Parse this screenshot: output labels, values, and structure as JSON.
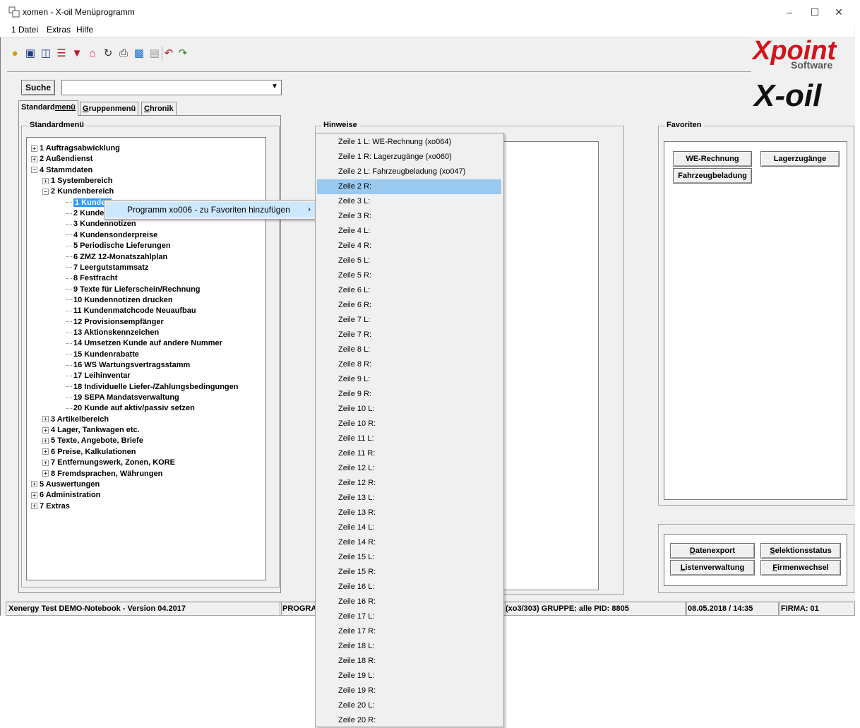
{
  "window": {
    "title": "xomen - X-oil Menüprogramm"
  },
  "menubar": [
    "1 Datei",
    "Extras",
    "Hilfe"
  ],
  "toolbar": [
    "lightbulb-icon",
    "info-icon",
    "book-icon",
    "database-icon",
    "filter-icon",
    "house-icon",
    "refresh-icon",
    "print-icon",
    "screen-icon",
    "save-icon",
    "undo-icon",
    "redo-icon"
  ],
  "logos": {
    "xpoint": "Xpoint",
    "software": "Software",
    "xoil": "X-oil"
  },
  "search": {
    "button": "Suche",
    "value": ""
  },
  "tabs": [
    {
      "pre": "Standard",
      "u": "menü",
      "post": ""
    },
    {
      "pre": "",
      "u": "G",
      "post": "ruppenmenü"
    },
    {
      "pre": "",
      "u": "C",
      "post": "hronik"
    }
  ],
  "std_group_title": "Standardmenü",
  "tree": [
    {
      "label": "1 Auftragsabwicklung",
      "level": 0,
      "exp": "+"
    },
    {
      "label": "2 Außendienst",
      "level": 0,
      "exp": "+"
    },
    {
      "label": "4 Stammdaten",
      "level": 0,
      "exp": "-"
    },
    {
      "label": "1 Systembereich",
      "level": 1,
      "exp": "+"
    },
    {
      "label": "2 Kundenbereich",
      "level": 1,
      "exp": "-"
    },
    {
      "label": "1 Kunden",
      "level": 2,
      "exp": "",
      "selected": true
    },
    {
      "label": "2 Kunder",
      "level": 2,
      "exp": ""
    },
    {
      "label": "3 Kundennotizen",
      "level": 2,
      "exp": ""
    },
    {
      "label": "4 Kundensonderpreise",
      "level": 2,
      "exp": ""
    },
    {
      "label": "5 Periodische Lieferungen",
      "level": 2,
      "exp": ""
    },
    {
      "label": "6 ZMZ 12-Monatszahlplan",
      "level": 2,
      "exp": ""
    },
    {
      "label": "7 Leergutstammsatz",
      "level": 2,
      "exp": ""
    },
    {
      "label": "8 Festfracht",
      "level": 2,
      "exp": ""
    },
    {
      "label": "9 Texte für Lieferschein/Rechnung",
      "level": 2,
      "exp": ""
    },
    {
      "label": "10 Kundennotizen drucken",
      "level": 2,
      "exp": ""
    },
    {
      "label": "11 Kundenmatchcode Neuaufbau",
      "level": 2,
      "exp": ""
    },
    {
      "label": "12 Provisionsempfänger",
      "level": 2,
      "exp": ""
    },
    {
      "label": "13 Aktionskennzeichen",
      "level": 2,
      "exp": ""
    },
    {
      "label": "14 Umsetzen Kunde auf andere Nummer",
      "level": 2,
      "exp": ""
    },
    {
      "label": "15 Kundenrabatte",
      "level": 2,
      "exp": ""
    },
    {
      "label": "16 WS Wartungsvertragsstamm",
      "level": 2,
      "exp": ""
    },
    {
      "label": "17 Leihinventar",
      "level": 2,
      "exp": ""
    },
    {
      "label": "18 Individuelle Liefer-/Zahlungsbedingungen",
      "level": 2,
      "exp": ""
    },
    {
      "label": "19 SEPA Mandatsverwaltung",
      "level": 2,
      "exp": ""
    },
    {
      "label": "20 Kunde auf aktiv/passiv setzen",
      "level": 2,
      "exp": ""
    },
    {
      "label": "3 Artikelbereich",
      "level": 1,
      "exp": "+"
    },
    {
      "label": "4 Lager, Tankwagen etc.",
      "level": 1,
      "exp": "+"
    },
    {
      "label": "5 Texte, Angebote, Briefe",
      "level": 1,
      "exp": "+"
    },
    {
      "label": "6 Preise, Kalkulationen",
      "level": 1,
      "exp": "+"
    },
    {
      "label": "7 Entfernungswerk, Zonen, KORE",
      "level": 1,
      "exp": "+"
    },
    {
      "label": "8 Fremdsprachen, Währungen",
      "level": 1,
      "exp": "+"
    },
    {
      "label": "5 Auswertungen",
      "level": 0,
      "exp": "+"
    },
    {
      "label": "6 Administration",
      "level": 0,
      "exp": "+"
    },
    {
      "label": "7 Extras",
      "level": 0,
      "exp": "+"
    }
  ],
  "context_menu": {
    "label": "Programm xo006 - zu Favoriten hinzufügen",
    "arrow": "›"
  },
  "hinweise_title": "Hinweise",
  "submenu": [
    "Zeile 1 L: WE-Rechnung (xo064)",
    "Zeile 1 R: Lagerzugänge (xo060)",
    "Zeile 2 L: Fahrzeugbeladung (xo047)",
    "Zeile 2 R:",
    "Zeile 3 L:",
    "Zeile 3 R:",
    "Zeile 4 L:",
    "Zeile 4 R:",
    "Zeile 5 L:",
    "Zeile 5 R:",
    "Zeile 6 L:",
    "Zeile 6 R:",
    "Zeile 7 L:",
    "Zeile 7 R:",
    "Zeile 8 L:",
    "Zeile 8 R:",
    "Zeile 9 L:",
    "Zeile 9 R:",
    "Zeile 10 L:",
    "Zeile 10 R:",
    "Zeile 11 L:",
    "Zeile 11 R:",
    "Zeile 12 L:",
    "Zeile 12 R:",
    "Zeile 13 L:",
    "Zeile 13 R:",
    "Zeile 14 L:",
    "Zeile 14 R:",
    "Zeile 15 L:",
    "Zeile 15 R:",
    "Zeile 16 L:",
    "Zeile 16 R:",
    "Zeile 17 L:",
    "Zeile 17 R:",
    "Zeile 18 L:",
    "Zeile 18 R:",
    "Zeile 19 L:",
    "Zeile 19 R:",
    "Zeile 20 L:",
    "Zeile 20 R:"
  ],
  "submenu_highlight": 3,
  "favoriten": {
    "title": "Favoriten",
    "buttons": [
      "WE-Rechnung",
      "Lagerzugänge",
      "Fahrzeugbeladung"
    ]
  },
  "actions": [
    {
      "u": "D",
      "rest": "atenexport"
    },
    {
      "u": "S",
      "rest": "elektionsstatus"
    },
    {
      "u": "L",
      "rest": "istenverwaltung"
    },
    {
      "u": "F",
      "rest": "irmenwechsel"
    }
  ],
  "status": {
    "version": "Xenergy Test DEMO-Notebook - Version 04.2017",
    "program": "PROGRA",
    "program_info": "(xo3/303)  GRUPPE: alle  PID: 8805",
    "datetime": "08.05.2018 / 14:35",
    "firma": "FIRMA: 01"
  }
}
